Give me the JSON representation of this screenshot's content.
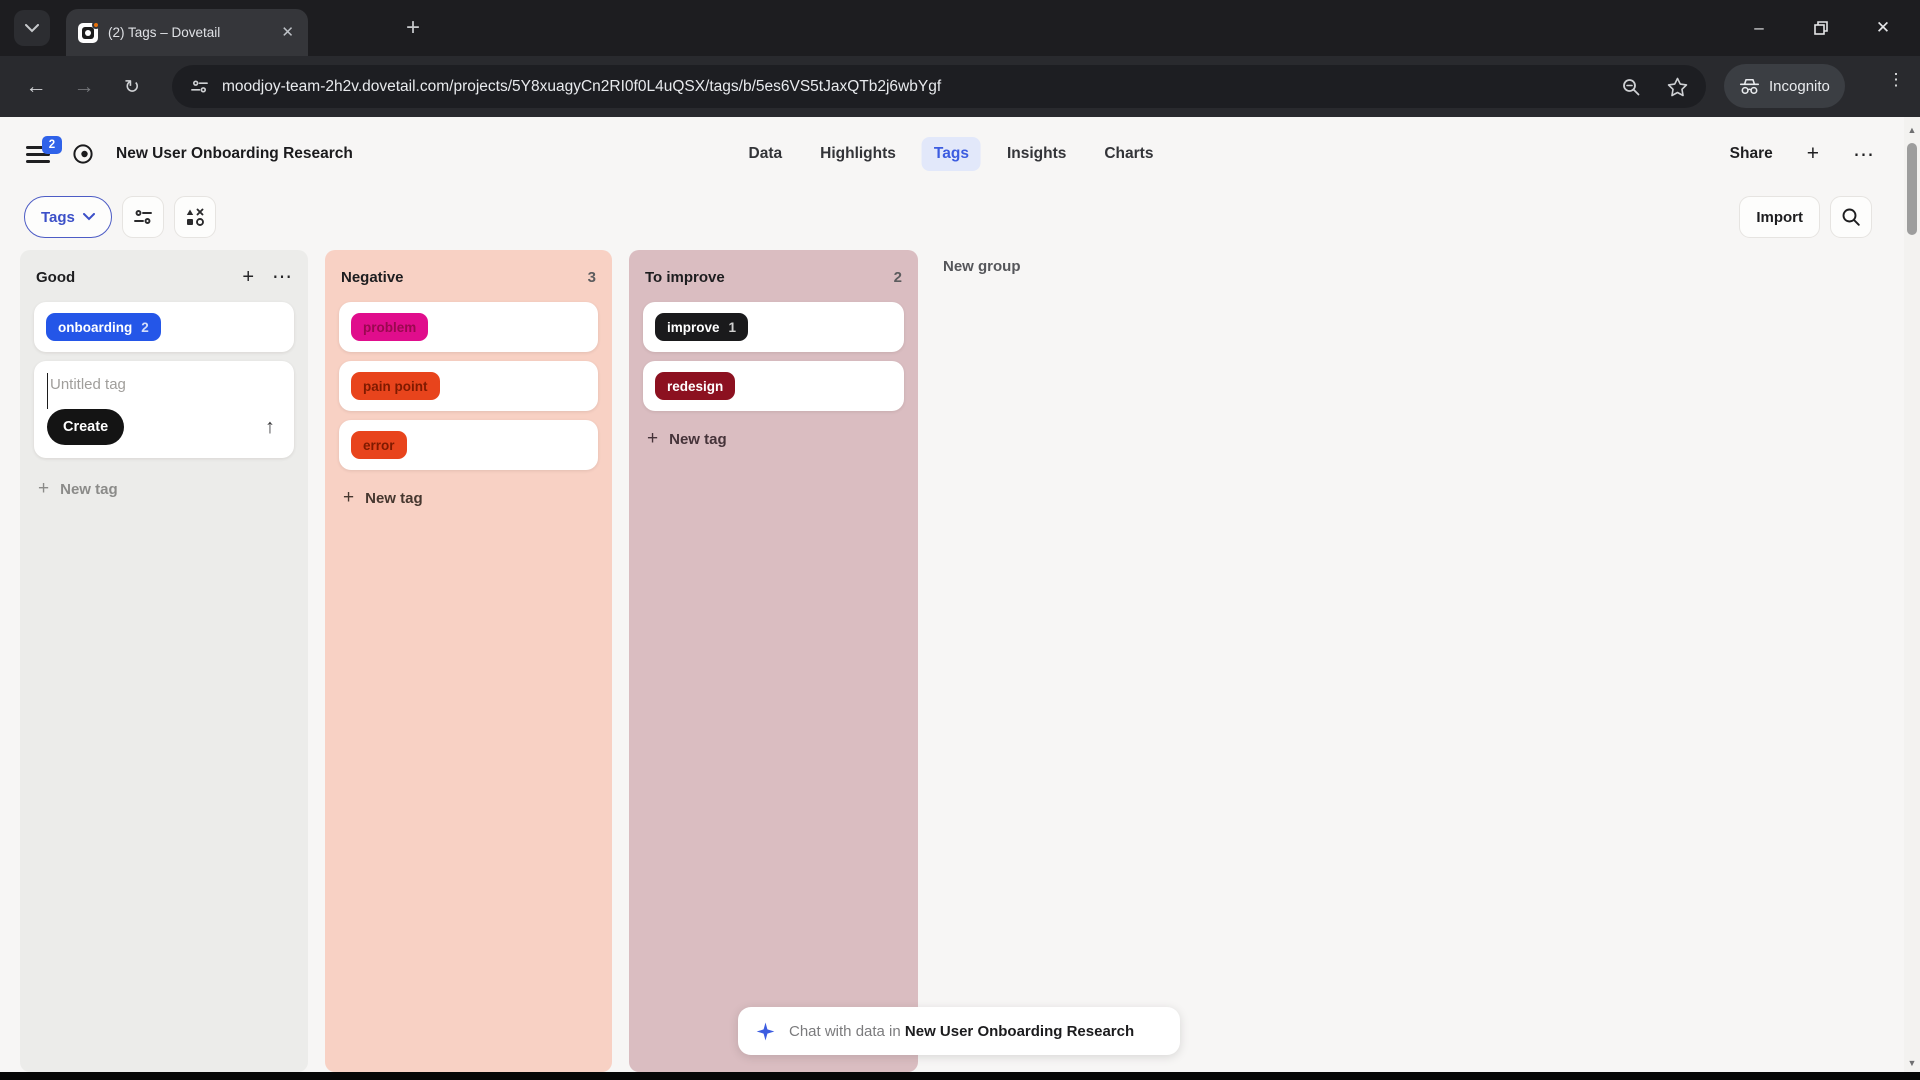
{
  "browser": {
    "tab_title": "(2) Tags – Dovetail",
    "url": "moodjoy-team-2h2v.dovetail.com/projects/5Y8xuagyCn2RI0f0L4uQSX/tags/b/5es6VS5tJaxQTb2j6wbYgf",
    "incognito_label": "Incognito"
  },
  "header": {
    "menu_badge": "2",
    "project_title": "New User Onboarding Research",
    "nav": [
      {
        "label": "Data"
      },
      {
        "label": "Highlights"
      },
      {
        "label": "Tags"
      },
      {
        "label": "Insights"
      },
      {
        "label": "Charts"
      }
    ],
    "active_nav": "Tags",
    "share_label": "Share"
  },
  "toolbar": {
    "view_label": "Tags",
    "import_label": "Import"
  },
  "board": {
    "columns": [
      {
        "name": "Good",
        "bg": "#ececea",
        "tags": [
          {
            "label": "onboarding",
            "count": "2",
            "bg": "#2456e8",
            "fg": "#ffffff"
          }
        ],
        "draft": {
          "placeholder": "Untitled tag",
          "create_label": "Create"
        },
        "new_tag_label": "New tag"
      },
      {
        "name": "Negative",
        "count": "3",
        "bg": "#f8d1c4",
        "tags": [
          {
            "label": "problem",
            "bg": "#e00d8c",
            "fg": "#99094f"
          },
          {
            "label": "pain point",
            "bg": "#e8441c",
            "fg": "#7f1a00"
          },
          {
            "label": "error",
            "bg": "#e8441c",
            "fg": "#7f1a00"
          }
        ],
        "new_tag_label": "New tag"
      },
      {
        "name": "To improve",
        "count": "2",
        "bg": "#dabdc1",
        "tags": [
          {
            "label": "improve",
            "count": "1",
            "bg": "#1a1a1c",
            "fg": "#ffffff"
          },
          {
            "label": "redesign",
            "bg": "#8c1120",
            "fg": "#ffffff"
          }
        ],
        "new_tag_label": "New tag"
      }
    ],
    "new_group_label": "New group"
  },
  "chat": {
    "prefix": "Chat with data in",
    "project": "New User Onboarding Research"
  },
  "colors": {
    "accent_blue": "#3c5ce0",
    "chrome_dark": "#1d1d20",
    "badge_blue": "#2f62e9"
  }
}
